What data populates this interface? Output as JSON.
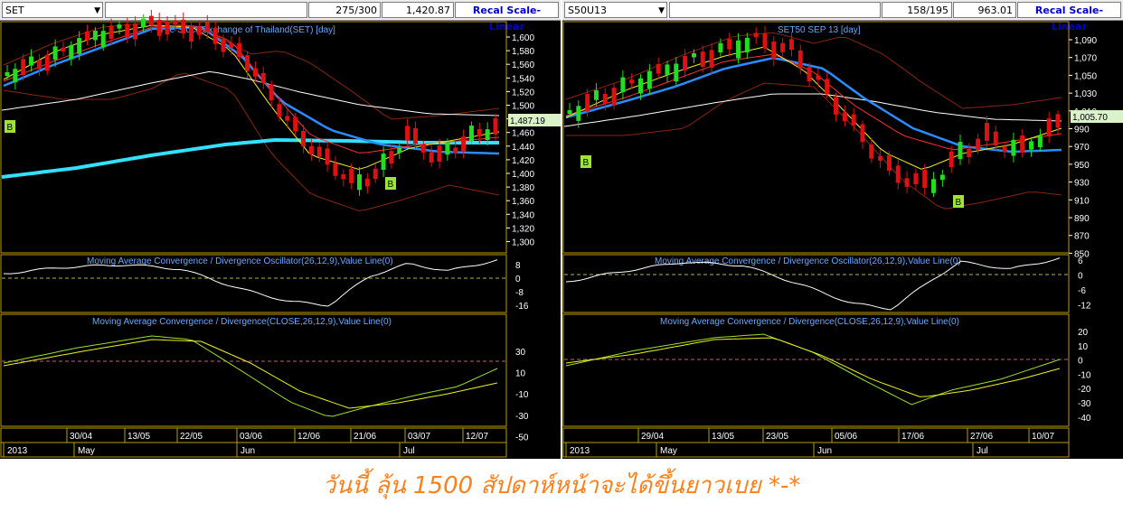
{
  "left": {
    "symbol": "SET",
    "count": "275/300",
    "price": "1,420.87",
    "recal_label": "Recal Scale-Linear",
    "main_title": "The Stock Exchange of Thailand(SET) [day]",
    "last_price": "1,487.19",
    "osc_title": "Moving Average Convergence / Divergence Oscillator(26,12,9),Value Line(0)",
    "macd_title": "Moving Average Convergence / Divergence(CLOSE,26,12,9),Value Line(0)",
    "price_ticks": [
      "1,600",
      "1,580",
      "1,560",
      "1,540",
      "1,520",
      "1,500",
      "1,480",
      "1,460",
      "1,440",
      "1,420",
      "1,400",
      "1,380",
      "1,360",
      "1,340",
      "1,320",
      "1,300"
    ],
    "osc_ticks": [
      "8",
      "0",
      "-8",
      "-16"
    ],
    "macd_ticks": [
      "30",
      "10",
      "-10",
      "-30",
      "-50"
    ],
    "dates": [
      "30/04",
      "13/05",
      "22/05",
      "03/06",
      "12/06",
      "21/06",
      "03/07",
      "12/07"
    ],
    "months": [
      "2013",
      "May",
      "Jun",
      "Jul"
    ],
    "signals": [
      "B",
      "B"
    ]
  },
  "right": {
    "symbol": "S50U13",
    "count": "158/195",
    "price": "963.01",
    "recal_label": "Recal Scale-Linear",
    "main_title": "SET50 SEP 13  [day]",
    "last_price": "1,005.70",
    "osc_title": "Moving Average Convergence / Divergence Oscillator(26,12,9),Value Line(0)",
    "macd_title": "Moving Average Convergence / Divergence(CLOSE,26,12,9),Value Line(0)",
    "price_ticks": [
      "1,090",
      "1,070",
      "1,050",
      "1,030",
      "1,010",
      "990",
      "970",
      "950",
      "930",
      "910",
      "890",
      "870",
      "850"
    ],
    "osc_ticks": [
      "6",
      "0",
      "-6",
      "-12"
    ],
    "macd_ticks": [
      "20",
      "10",
      "0",
      "-10",
      "-20",
      "-30",
      "-40"
    ],
    "dates": [
      "29/04",
      "13/05",
      "23/05",
      "05/06",
      "17/06",
      "27/06",
      "10/07"
    ],
    "months": [
      "2013",
      "May",
      "Jun",
      "Jul"
    ],
    "signals": [
      "B",
      "B"
    ]
  },
  "caption": "วันนี้ ลุ้น 1500 สัปดาห์หน้าจะได้ขึ้นยาวเบย *-*",
  "colors": {
    "bull": "#22dd22",
    "bear": "#dd1111",
    "ma_blue": "#2a8cff",
    "ma_cyan": "#33e0ff",
    "ma_white": "#ffffff",
    "ma_yellow": "#f0f020",
    "ma_red": "#ff3030",
    "band": "#8a2510",
    "grid_gold": "#b8a000",
    "osc_line": "#ffffff",
    "macd_yellow": "#f0f020",
    "macd_green": "#9be02a",
    "zero_line": "#c06080",
    "axis_text": "#ffffff",
    "title_text": "#6aa8ff",
    "caption": "#ff7f1a"
  }
}
